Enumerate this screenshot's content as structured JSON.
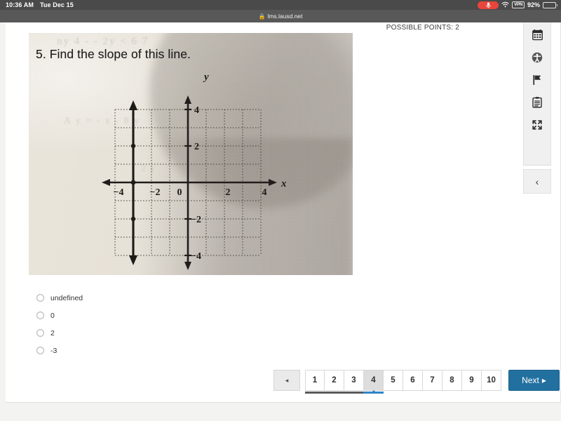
{
  "status_bar": {
    "time": "10:36 AM",
    "date": "Tue Dec 15",
    "mic_icon": "microphone-icon",
    "wifi_icon": "wifi-icon",
    "vpn_label": "VPN",
    "battery_percent": "92%"
  },
  "browser": {
    "lock_glyph": "🔒",
    "url": "lms.lausd.net"
  },
  "header": {
    "possible_points": "POSSIBLE POINTS: 2"
  },
  "tool_rail": {
    "items": [
      {
        "name": "calculator-icon",
        "title": "Calculator"
      },
      {
        "name": "accessibility-icon",
        "title": "Accessibility"
      },
      {
        "name": "flag-icon",
        "title": "Flag question"
      },
      {
        "name": "notepad-icon",
        "title": "Notepad"
      },
      {
        "name": "fullscreen-icon",
        "title": "Full screen"
      }
    ],
    "collapse_glyph": "‹"
  },
  "question": {
    "number_and_text": "5. Find the slope of this line.",
    "ghost_line_1": "ny 4 - - 2y < 6 7",
    "ghost_line_2": "A y = - x - 8 y",
    "ghost_line_3": "2 x"
  },
  "chart_data": {
    "type": "line",
    "title": "5. Find the slope of this line.",
    "xlabel": "x",
    "ylabel": "y",
    "xlim": [
      -4.5,
      4.5
    ],
    "ylim": [
      -4.5,
      4.5
    ],
    "xticks": [
      -4,
      -2,
      0,
      2,
      4
    ],
    "yticks": [
      -4,
      -2,
      0,
      2,
      4
    ],
    "xtick_labels": [
      "−4",
      "−2",
      "0",
      "2",
      "4"
    ],
    "ytick_labels": [
      "−4",
      "−2",
      "",
      "2",
      "4"
    ],
    "grid": true,
    "grid_style": "dotted",
    "axis_arrows": true,
    "series": [
      {
        "name": "plotted line",
        "equation": "x = -3",
        "style": "vertical-line-with-arrows",
        "x": [
          -3,
          -3
        ],
        "y": [
          -4,
          4
        ],
        "points": [
          {
            "x": -3,
            "y": 2
          },
          {
            "x": -3,
            "y": 0
          },
          {
            "x": -3,
            "y": -2
          }
        ]
      }
    ]
  },
  "options": [
    {
      "label": "undefined",
      "selected": false
    },
    {
      "label": "0",
      "selected": false
    },
    {
      "label": "2",
      "selected": false
    },
    {
      "label": "-3",
      "selected": false
    }
  ],
  "pagination": {
    "prev_glyph": "◂",
    "pages": [
      {
        "label": "1",
        "state": "done"
      },
      {
        "label": "2",
        "state": "done"
      },
      {
        "label": "3",
        "state": "done"
      },
      {
        "label": "4",
        "state": "active"
      },
      {
        "label": "5",
        "state": "normal"
      },
      {
        "label": "6",
        "state": "normal"
      },
      {
        "label": "7",
        "state": "normal"
      },
      {
        "label": "8",
        "state": "normal"
      },
      {
        "label": "9",
        "state": "normal"
      },
      {
        "label": "10",
        "state": "normal"
      }
    ],
    "next_label": "Next",
    "next_glyph": "▸",
    "next_color": "#22709f"
  }
}
